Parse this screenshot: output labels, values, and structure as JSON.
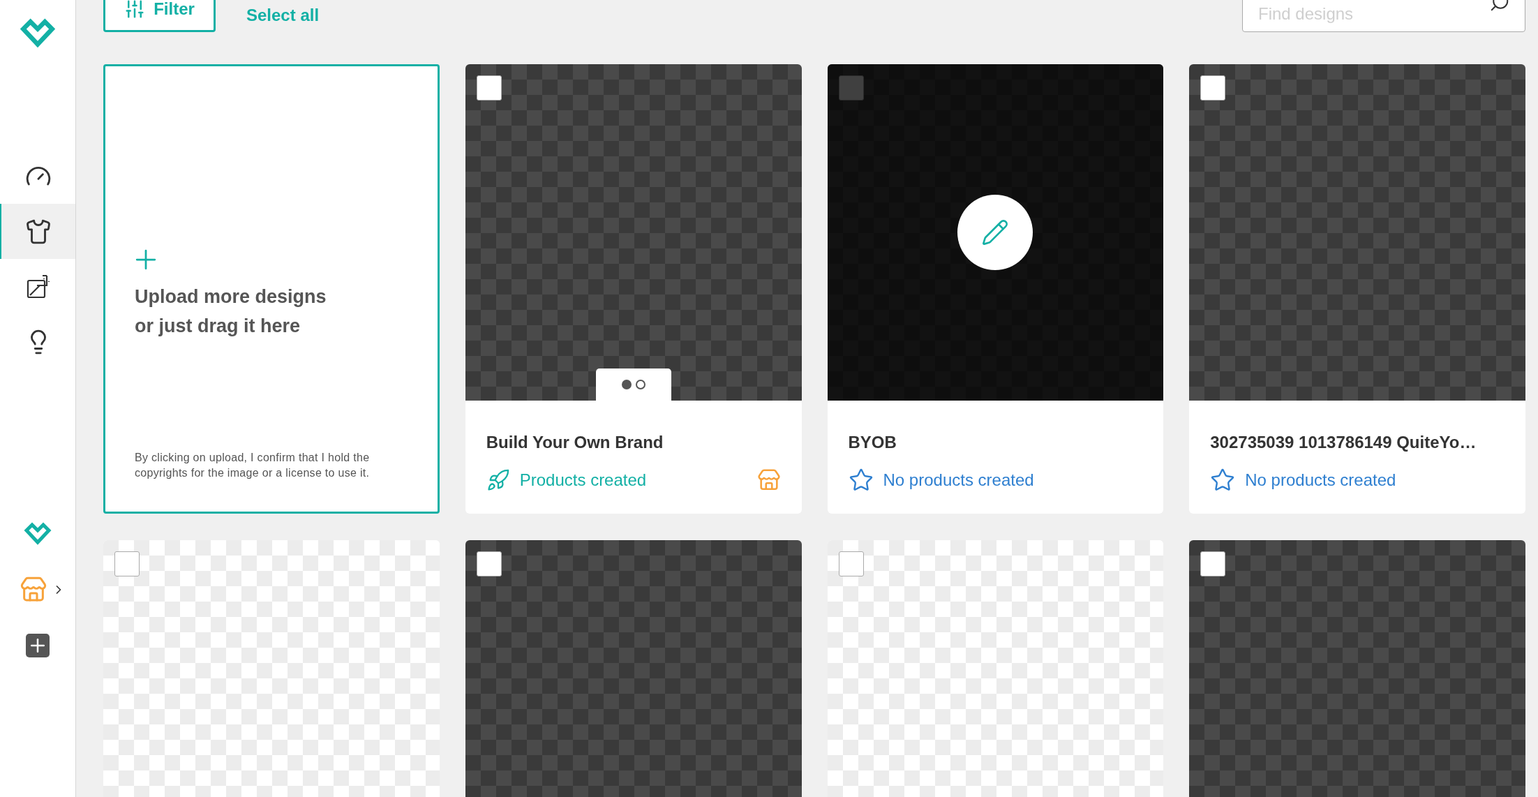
{
  "toolbar": {
    "filter_label": "Filter",
    "select_all_label": "Select all",
    "search": {
      "placeholder": "Find designs"
    }
  },
  "sidebar": {
    "nav": [
      {
        "kind": "gauge",
        "selected": false
      },
      {
        "kind": "shirt",
        "selected": true
      },
      {
        "kind": "chart",
        "selected": false
      },
      {
        "kind": "bulb",
        "selected": false
      }
    ],
    "bottom": [
      {
        "kind": "logo"
      },
      {
        "kind": "shop"
      },
      {
        "kind": "add"
      }
    ]
  },
  "upload": {
    "title": "Upload more designs or just drag it here",
    "notice": "By clicking on upload, I confirm that I hold the copyrights for the image or a license to use it."
  },
  "designs": [
    {
      "kind": "dark",
      "checked": false,
      "hovered": false,
      "slides": [
        {
          "selected": true
        },
        {
          "selected": false
        }
      ],
      "title": "Build Your Own Brand",
      "status": "Products created",
      "products_created": true,
      "in_shop": true
    },
    {
      "kind": "dark",
      "checked": false,
      "hovered": true,
      "title": "BYOB",
      "status": "No products created",
      "products_created": false,
      "in_shop": false
    },
    {
      "kind": "dark",
      "checked": false,
      "hovered": false,
      "title": "302735039 1013786149 QuiteYo…",
      "status": "No products created",
      "products_created": false,
      "in_shop": false
    },
    {
      "kind": "light",
      "checked": false,
      "hovered": false
    },
    {
      "kind": "dark",
      "checked": false,
      "hovered": false
    },
    {
      "kind": "light",
      "checked": false,
      "hovered": false
    },
    {
      "kind": "dark",
      "checked": false,
      "hovered": false
    }
  ]
}
